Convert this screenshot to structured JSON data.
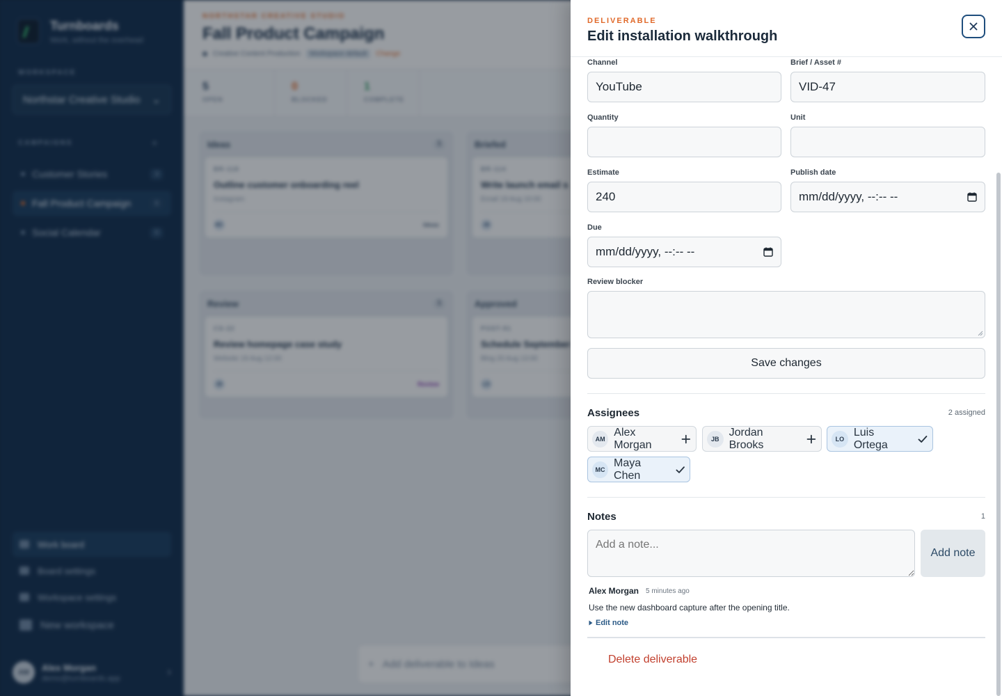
{
  "sidebar": {
    "brand_name": "Turnboards",
    "brand_tagline": "Work, without the overhead",
    "workspace_label": "WORKSPACE",
    "workspace_value": "Northstar Creative Studio",
    "campaigns_label": "CAMPAIGNS",
    "campaigns": [
      {
        "label": "Customer Stories",
        "count": "3"
      },
      {
        "label": "Fall Product Campaign",
        "count": "6"
      },
      {
        "label": "Social Calendar",
        "count": "0"
      }
    ],
    "nav": [
      {
        "label": "Work board"
      },
      {
        "label": "Board settings"
      },
      {
        "label": "Workspace settings"
      },
      {
        "label": "New workspace"
      }
    ],
    "user": {
      "name": "Alex Morgan",
      "email": "demo@turnboards.app",
      "initials": "AM"
    }
  },
  "main": {
    "eyebrow": "NORTHSTAR CREATIVE STUDIO",
    "title": "Fall Product Campaign",
    "meta_template": "Creative Content Production",
    "meta_tag": "Workspace default",
    "meta_link": "Change",
    "stats": [
      {
        "value": "5",
        "label": "OPEN",
        "color": "#26415f"
      },
      {
        "value": "0",
        "label": "BLOCKED",
        "color": "#e36c2a"
      },
      {
        "value": "1",
        "label": "COMPLETE",
        "color": "#2f9a62"
      }
    ],
    "columns": [
      {
        "name": "Ideas",
        "count": "1",
        "card": {
          "id": "BR-118",
          "title": "Outline customer onboarding reel",
          "meta": "Instagram",
          "avatar": "MC",
          "stage": "Ideas"
        }
      },
      {
        "name": "Briefed",
        "count": "",
        "card": {
          "id": "BR-114",
          "title": "Write launch email s",
          "meta": "Email   19 Aug 10:00",
          "avatar": "JB",
          "stage": ""
        }
      },
      {
        "name": "Review",
        "count": "1",
        "card": {
          "id": "CS-22",
          "title": "Review homepage case study",
          "meta": "Website   19 Aug 12:00",
          "avatar": "JB",
          "stage": "Review"
        }
      },
      {
        "name": "Approved",
        "count": "",
        "card": {
          "id": "POST-91",
          "title": "Schedule September",
          "meta": "Blog   20 Aug 13:00",
          "avatar": "LO",
          "stage": ""
        }
      }
    ],
    "add_deliverable": "Add deliverable to Ideas"
  },
  "drawer": {
    "eyebrow": "DELIVERABLE",
    "title": "Edit installation walkthrough",
    "fields": {
      "channel": {
        "label": "Channel",
        "value": "YouTube"
      },
      "brief": {
        "label": "Brief / Asset #",
        "value": "VID-47"
      },
      "quantity": {
        "label": "Quantity",
        "value": ""
      },
      "unit": {
        "label": "Unit",
        "value": ""
      },
      "estimate": {
        "label": "Estimate",
        "value": "240"
      },
      "publish_date": {
        "label": "Publish date",
        "value": "mm/dd/yyyy, --:-- --"
      },
      "due": {
        "label": "Due",
        "value": "mm/dd/yyyy, --:-- --"
      },
      "review_blocker": {
        "label": "Review blocker",
        "value": ""
      }
    },
    "save_label": "Save changes",
    "assignees": {
      "title": "Assignees",
      "count": "2 assigned",
      "people": [
        {
          "initials": "AM",
          "name": "Alex Morgan",
          "selected": false
        },
        {
          "initials": "JB",
          "name": "Jordan Brooks",
          "selected": false
        },
        {
          "initials": "LO",
          "name": "Luis Ortega",
          "selected": true
        },
        {
          "initials": "MC",
          "name": "Maya Chen",
          "selected": true
        }
      ]
    },
    "notes": {
      "title": "Notes",
      "count": "1",
      "placeholder": "Add a note...",
      "add_label": "Add note",
      "items": [
        {
          "author": "Alex Morgan",
          "time": "5 minutes ago",
          "body": "Use the new dashboard capture after the opening title.",
          "edit_label": "Edit note"
        }
      ]
    },
    "delete_label": "Delete deliverable"
  },
  "colors": {
    "accent": "#e0692a",
    "primary": "#1f4e7d",
    "danger": "#c2402e",
    "sidebar_bg": "#0e2a4a"
  }
}
